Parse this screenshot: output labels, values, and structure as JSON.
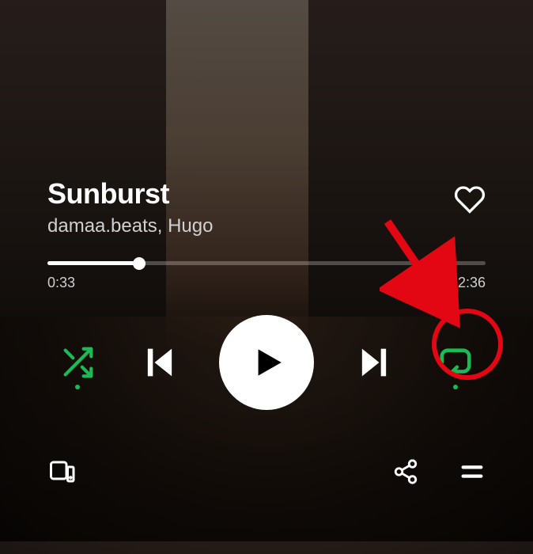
{
  "track": {
    "title": "Sunburst",
    "artist": "damaa.beats, Hugo",
    "liked": false
  },
  "progress": {
    "elapsed": "0:33",
    "total": "2:36",
    "fraction": 0.21
  },
  "controls": {
    "shuffle_active": true,
    "repeat_mode": "one"
  },
  "colors": {
    "accent": "#1db954",
    "annotation": "#e30613"
  }
}
